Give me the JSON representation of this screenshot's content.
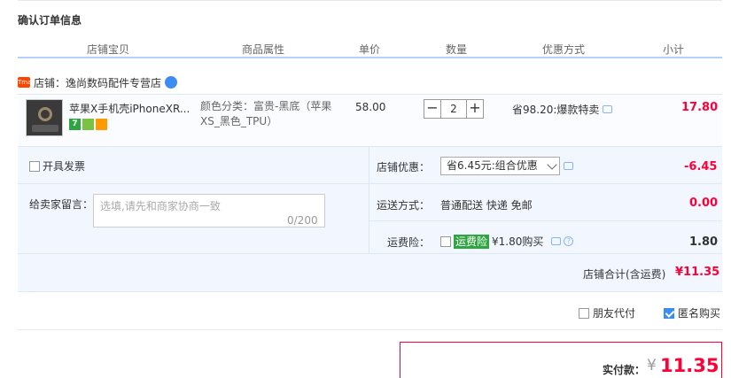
{
  "title": "确认订单信息",
  "columns": [
    "店铺宝贝",
    "商品属性",
    "单价",
    "数量",
    "优惠方式",
    "小计"
  ],
  "shop": {
    "tag": "Tmall",
    "label": "店铺：逸尚数码配件专营店"
  },
  "item": {
    "name": "苹果X手机壳iPhoneXR...",
    "badges": [
      "7",
      "",
      ""
    ],
    "attr": "颜色分类：富贵-黑底（苹果XS_黑色_TPU）",
    "price": "58.00",
    "qty": "2",
    "minus": "−",
    "plus": "+",
    "promo": "省98.20:爆款特卖",
    "subtotal": "17.80"
  },
  "invoice_label": "开具发票",
  "shop_discount": {
    "label": "店铺优惠：",
    "selected": "省6.45元:组合优惠",
    "amount": "-6.45"
  },
  "message": {
    "label": "给卖家留言：",
    "placeholder": "选填,请先和商家协商一致",
    "counter": "0/200"
  },
  "shipping": {
    "label": "运送方式：",
    "value": "普通配送 快递 免邮",
    "amount": "0.00"
  },
  "insurance": {
    "label": "运费险：",
    "badge": "运费险",
    "value": "¥1.80购买",
    "amount": "1.80"
  },
  "shop_total": {
    "label": "店铺合计(含运费)",
    "amount": "¥11.35"
  },
  "friend_pay": "朋友代付",
  "anonymous": "匿名购买",
  "actual": {
    "label": "实付款：",
    "currency": "¥",
    "amount": "11.35"
  },
  "colors": {
    "accent": "#ff0036",
    "header_line": "#b2d1ff",
    "panel": "#f2f7ff",
    "blue": "#3d8cf0",
    "green": "#2ea541"
  }
}
